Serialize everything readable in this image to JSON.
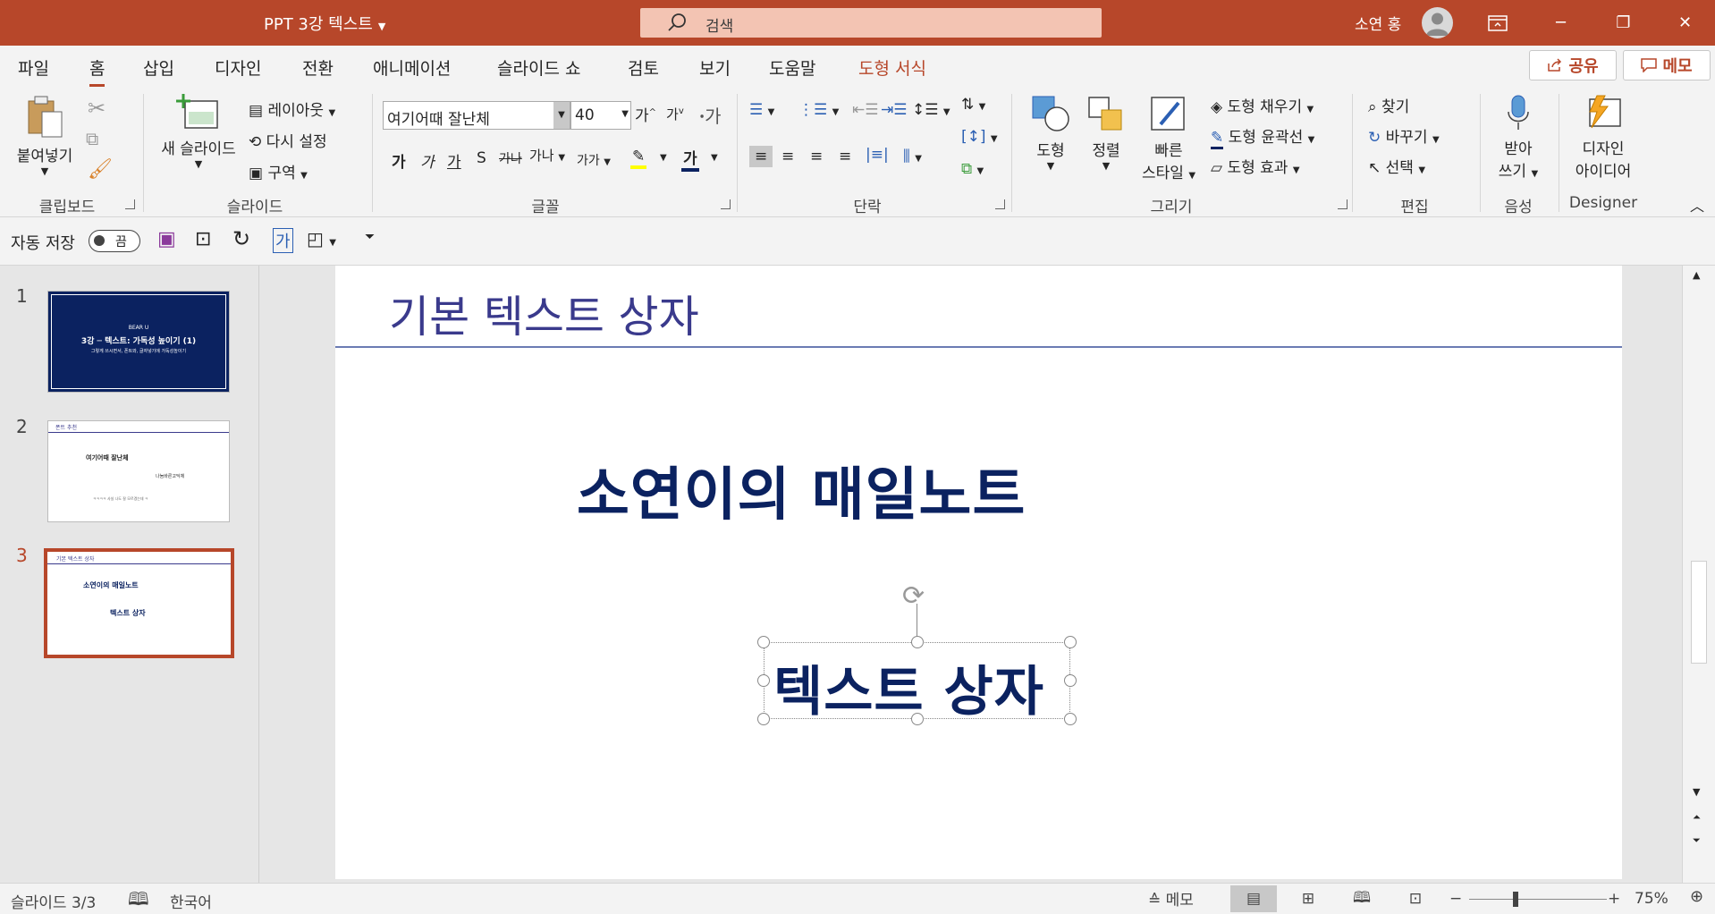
{
  "titlebar": {
    "doc_title": "PPT 3강 텍스트",
    "search_placeholder": "검색",
    "user_name": "소연 홍"
  },
  "tabs": [
    {
      "label": "파일"
    },
    {
      "label": "홈"
    },
    {
      "label": "삽입"
    },
    {
      "label": "디자인"
    },
    {
      "label": "전환"
    },
    {
      "label": "애니메이션"
    },
    {
      "label": "슬라이드 쇼"
    },
    {
      "label": "검토"
    },
    {
      "label": "보기"
    },
    {
      "label": "도움말"
    },
    {
      "label": "도형 서식"
    }
  ],
  "share_label": "공유",
  "memo_label": "메모",
  "ribbon": {
    "clipboard": {
      "paste": "붙여넣기",
      "label": "클립보드"
    },
    "slides": {
      "new_slide": "새 슬라이드",
      "layout": "레이아웃",
      "reset": "다시 설정",
      "section": "구역",
      "label": "슬라이드"
    },
    "font": {
      "name": "여기어때 잘난체",
      "size": "40",
      "grow": "가",
      "shrink": "가",
      "bold": "가",
      "italic": "가",
      "underline": "가",
      "shadow": "S",
      "strike": "가나",
      "spacing": "가나",
      "case": "가가",
      "color": "가",
      "label": "글꼴"
    },
    "paragraph": {
      "label": "단락"
    },
    "drawing": {
      "shapes": "도형",
      "arrange": "정렬",
      "quick_styles_1": "빠른",
      "quick_styles_2": "스타일",
      "fill": "도형 채우기",
      "outline": "도형 윤곽선",
      "effects": "도형 효과",
      "label": "그리기"
    },
    "editing": {
      "find": "찾기",
      "replace": "바꾸기",
      "select": "선택",
      "label": "편집"
    },
    "voice": {
      "dictate_1": "받아",
      "dictate_2": "쓰기",
      "label": "음성"
    },
    "designer": {
      "ideas_1": "디자인",
      "ideas_2": "아이디어",
      "label": "Designer"
    }
  },
  "qat": {
    "autosave_label": "자동 저장",
    "autosave_state": "끔"
  },
  "thumbnails": [
    {
      "number": "1",
      "kicker": "BEAR U",
      "title": "3강 ─ 텍스트: 가독성 높이기 (1)",
      "subtitle": "그렇게 쓰시면서, 폰트와, 글자넣기에 가독성높이기"
    },
    {
      "number": "2",
      "header": "폰트 추천",
      "line1": "여기어때 잘난체",
      "line2": "나눔바른고딕체",
      "line3": "ㅋㅋㅋㅋ 사실 나도 잘 모르겠는데 ㅋ"
    },
    {
      "number": "3",
      "header": "기본 텍스트 상자",
      "line1": "소연이의 매일노트",
      "line2": "텍스트 상자"
    }
  ],
  "slide": {
    "title": "기본 텍스트 상자",
    "body_text": "소연이의 매일노트",
    "textbox_text": "텍스트 상자"
  },
  "statusbar": {
    "slide_count": "슬라이드 3/3",
    "language": "한국어",
    "notes": "메모",
    "zoom": "75%"
  },
  "colors": {
    "accent": "#b7472a",
    "navy": "#0b2260"
  }
}
